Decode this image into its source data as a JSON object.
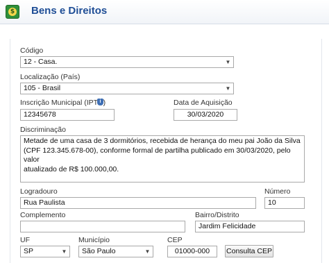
{
  "header": {
    "title": "Bens e Direitos",
    "icon": "money-icon"
  },
  "codigo": {
    "label": "Código",
    "value": "12 - Casa."
  },
  "localizacao": {
    "label": "Localização (País)",
    "value": "105 - Brasil"
  },
  "iptu": {
    "label": "Inscrição Municipal (IPTU)",
    "value": "12345678",
    "info_icon": "info-shield-icon"
  },
  "data_aquisicao": {
    "label": "Data de Aquisição",
    "value": "30/03/2020"
  },
  "discriminacao": {
    "label": "Discriminação",
    "lines": [
      "Metade de uma casa de 3 dormitórios, recebida de herança do meu pai João da Silva",
      "(CPF 123.345.678-00), conforme formal de partilha publicado em 30/03/2020, pelo valor",
      "atualizado de R$ 100.000,00."
    ]
  },
  "logradouro": {
    "label": "Logradouro",
    "value": "Rua Paulista"
  },
  "numero": {
    "label": "Número",
    "value": "10"
  },
  "complemento": {
    "label": "Complemento",
    "value": ""
  },
  "bairro": {
    "label": "Bairro/Distrito",
    "value": "Jardim Felicidade"
  },
  "uf": {
    "label": "UF",
    "value": "SP"
  },
  "municipio": {
    "label": "Município",
    "value": "São Paulo"
  },
  "cep": {
    "label": "CEP",
    "value": "01000-000",
    "button": "Consulta CEP"
  }
}
